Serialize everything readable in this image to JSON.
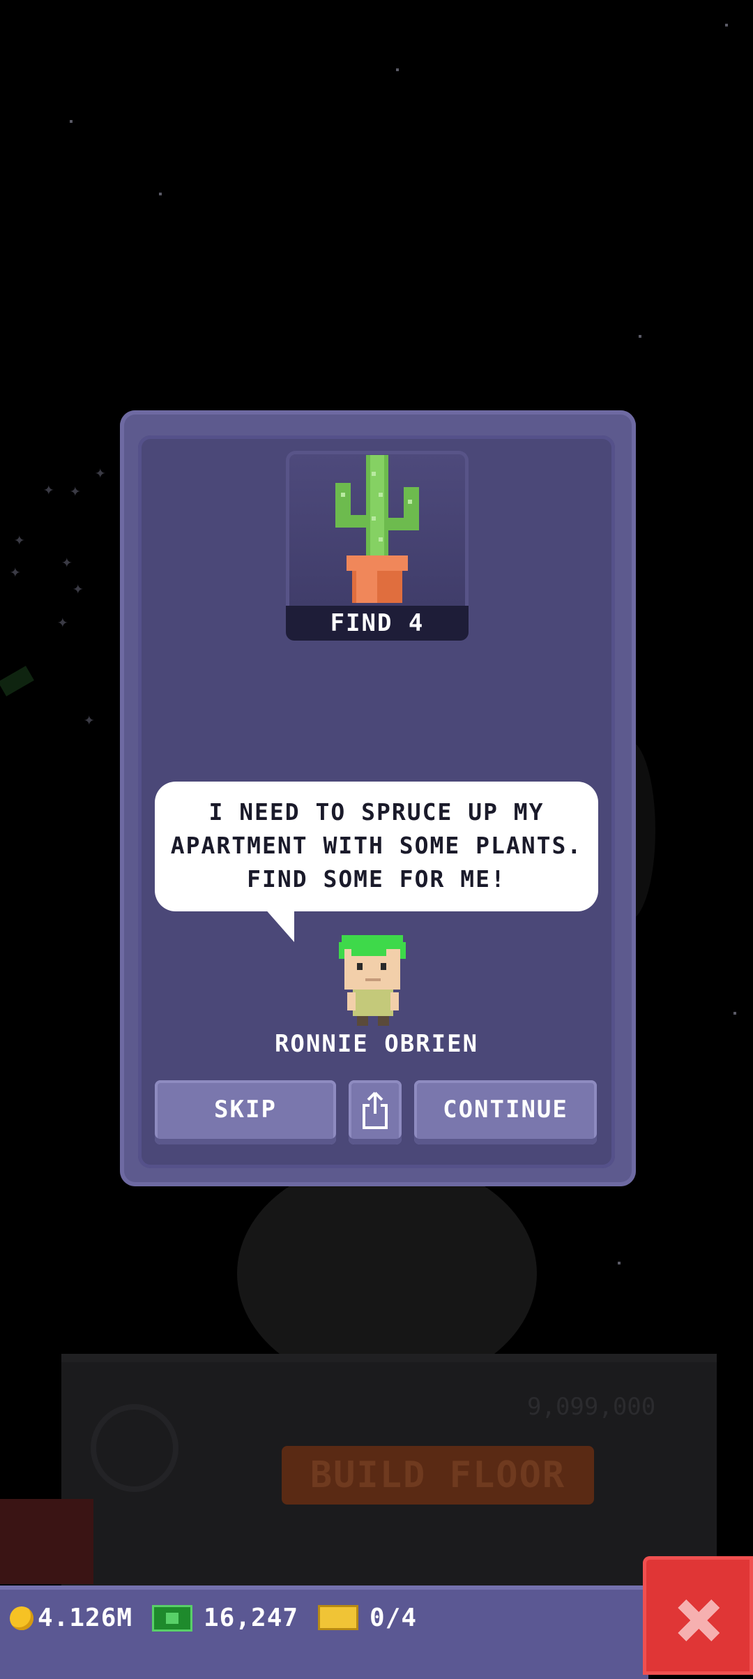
{
  "quest": {
    "find_label": "FIND 4",
    "item_icon": "cactus-icon",
    "speech": "I NEED TO SPRUCE UP MY APARTMENT WITH SOME PLANTS. FIND SOME FOR ME!",
    "character_name": "RONNIE OBRIEN"
  },
  "buttons": {
    "skip": "SKIP",
    "share_icon": "share-icon",
    "continue": "CONTINUE"
  },
  "background": {
    "build_floor": "BUILD FLOOR",
    "floor_price": "9,099,000"
  },
  "status_bar": {
    "coins": "4.126M",
    "bux": "16,247",
    "tickets": "0/4",
    "close_icon": "close-icon"
  },
  "colors": {
    "modal": "#5d5a8e",
    "modal_inner": "#4b4878",
    "button": "#7a77ad",
    "close": "#e03636"
  }
}
